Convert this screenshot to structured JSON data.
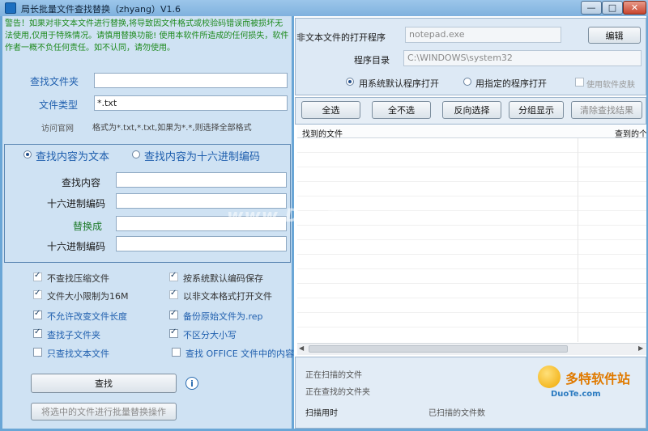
{
  "window": {
    "title": "局长批量文件查找替换（zhyang）V1.6",
    "min_glyph": "—",
    "max_glyph": "□",
    "close_glyph": "✕"
  },
  "left": {
    "warning": "警告！如果对非文本文件进行替换,将导致因文件格式或校验码错误而被损坏无法使用,仅用于特殊情况。请慎用替换功能! 使用本软件所造成的任何损失，软件作者一概不负任何责任。如不认同，请勿使用。",
    "find_folder_label": "查找文件夹",
    "find_folder_value": "",
    "file_type_label": "文件类型",
    "file_type_value": "*.txt",
    "visit_site": "访问官网",
    "format_hint": "格式为*.txt,*.txt,如果为*.*,则选择全部格式",
    "mode_text_label": "查找内容为文本",
    "mode_hex_label": "查找内容为十六进制编码",
    "find_content_label": "查找内容",
    "hex1_label": "十六进制编码",
    "replace_label": "替换成",
    "hex2_label": "十六进制编码",
    "options": [
      {
        "label": "不查找压缩文件",
        "checked": true,
        "disabled": true
      },
      {
        "label": "按系统默认编码保存",
        "checked": true,
        "disabled": true
      },
      {
        "label": "文件大小限制为16M",
        "checked": true,
        "disabled": true
      },
      {
        "label": "以非文本格式打开文件",
        "checked": true,
        "disabled": true
      },
      {
        "label": "不允许改变文件长度",
        "checked": true,
        "disabled": false
      },
      {
        "label": "备份原始文件为.rep",
        "checked": true,
        "disabled": false
      },
      {
        "label": "查找子文件夹",
        "checked": true,
        "disabled": false
      },
      {
        "label": "不区分大小写",
        "checked": true,
        "disabled": false
      },
      {
        "label": "只查找文本文件",
        "checked": false,
        "disabled": false
      },
      {
        "label": "查找 OFFICE 文件中的内容",
        "checked": false,
        "disabled": false
      }
    ],
    "find_button": "查找",
    "info_glyph": "i",
    "batch_replace_button": "将选中的文件进行批量替换操作"
  },
  "right": {
    "open_program_label": "非文本文件的打开程序",
    "open_program_value": "notepad.exe",
    "edit_button": "编辑",
    "program_dir_label": "程序目录",
    "program_dir_value": "C:\\WINDOWS\\system32",
    "use_default_label": "用系统默认程序打开",
    "use_specified_label": "用指定的程序打开",
    "use_skin_label": "使用软件皮肤",
    "toolbar": {
      "select_all": "全选",
      "select_none": "全不选",
      "invert": "反向选择",
      "group_show": "分组显示",
      "clear_results": "清除查找结果"
    },
    "columns": [
      "找到的文件",
      "查到的个"
    ],
    "status": {
      "scanning_file": "正在扫描的文件",
      "finding_file": "正在查找的文件夹",
      "scan_time": "扫描用时",
      "scanned_count": "已扫描的文件数"
    }
  },
  "branding": {
    "logo_text": "多特软件站",
    "logo_sub": "DuoTe.com",
    "watermark": "www.DuoTe.com"
  }
}
